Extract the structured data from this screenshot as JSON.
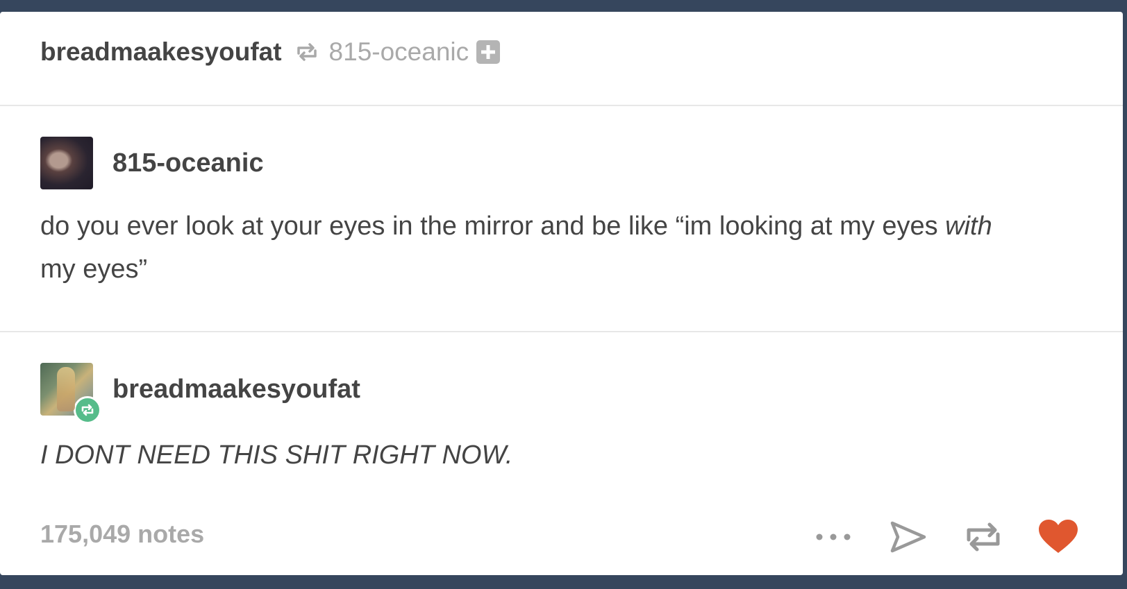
{
  "header": {
    "reblogger": "breadmaakesyoufat",
    "source": "815-oceanic",
    "reblog_icon": "reblog-icon",
    "follow_icon": "plus-icon"
  },
  "trail": [
    {
      "username": "815-oceanic",
      "body_part1": "do you ever look at your eyes in the mirror and be like “im looking at my eyes ",
      "body_emphasis": "with",
      "body_part2": " my eyes”"
    },
    {
      "username": "breadmaakesyoufat",
      "body": "I DONT NEED THIS SHIT RIGHT NOW.",
      "badge_icon": "reblog-badge-icon",
      "badge_color": "#56bc8a"
    }
  ],
  "footer": {
    "notes": "175,049 notes",
    "controls": [
      "more-icon",
      "share-icon",
      "reblog-icon",
      "like-heart-icon"
    ],
    "like_color": "#e0572f"
  },
  "colors": {
    "background": "#36465d",
    "text": "#444444",
    "muted": "#a9a9a9"
  }
}
